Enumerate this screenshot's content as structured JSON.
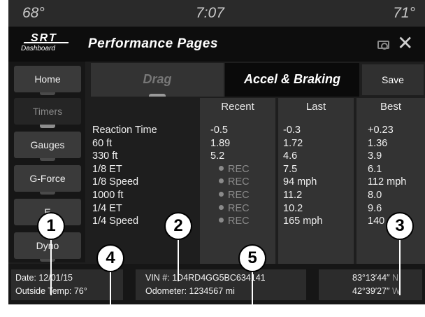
{
  "status": {
    "temp_left": "68°",
    "time": "7:07",
    "temp_right": "71°"
  },
  "header": {
    "logo_srt": "SRT",
    "logo_dashboard": "Dashboard",
    "title": "Performance Pages"
  },
  "sidebar": {
    "items": [
      {
        "label": "Home"
      },
      {
        "label": "Timers"
      },
      {
        "label": "Gauges"
      },
      {
        "label": "G-Force"
      },
      {
        "label": "E"
      },
      {
        "label": "Dyno"
      }
    ]
  },
  "tabs": {
    "drag": "Drag",
    "accel": "Accel & Braking",
    "save": "Save"
  },
  "table": {
    "headers": [
      "Recent",
      "Last",
      "Best"
    ],
    "rows": [
      {
        "label": "Reaction Time",
        "recent": "-0.5",
        "last": "-0.3",
        "best": "+0.23"
      },
      {
        "label": "60 ft",
        "recent": "1.89",
        "last": "1.72",
        "best": "1.36"
      },
      {
        "label": "330 ft",
        "recent": "5.2",
        "last": "4.6",
        "best": "3.9"
      },
      {
        "label": "1/8 ET",
        "recent": "REC",
        "last": "7.5",
        "best": "6.1"
      },
      {
        "label": "1/8 Speed",
        "recent": "REC",
        "last": "94 mph",
        "best": "112 mph"
      },
      {
        "label": "1000 ft",
        "recent": "REC",
        "last": "11.2",
        "best": "8.0"
      },
      {
        "label": "1/4 ET",
        "recent": "REC",
        "last": "10.2",
        "best": "9.6"
      },
      {
        "label": "1/4 Speed",
        "recent": "REC",
        "last": "165 mph",
        "best": "140 mph"
      }
    ]
  },
  "footer": {
    "date": "Date: 12/01/15",
    "outside_temp": "Outside Temp: 76°",
    "vin": "VIN #: 1D4RD4GG5BC634141",
    "odometer": "Odometer: 1234567 mi",
    "lat_value": "83°13′44″",
    "lat_dir": "N",
    "lon_value": "42°39′27″",
    "lon_dir": "W"
  },
  "callouts": [
    "1",
    "2",
    "3",
    "4",
    "5"
  ]
}
